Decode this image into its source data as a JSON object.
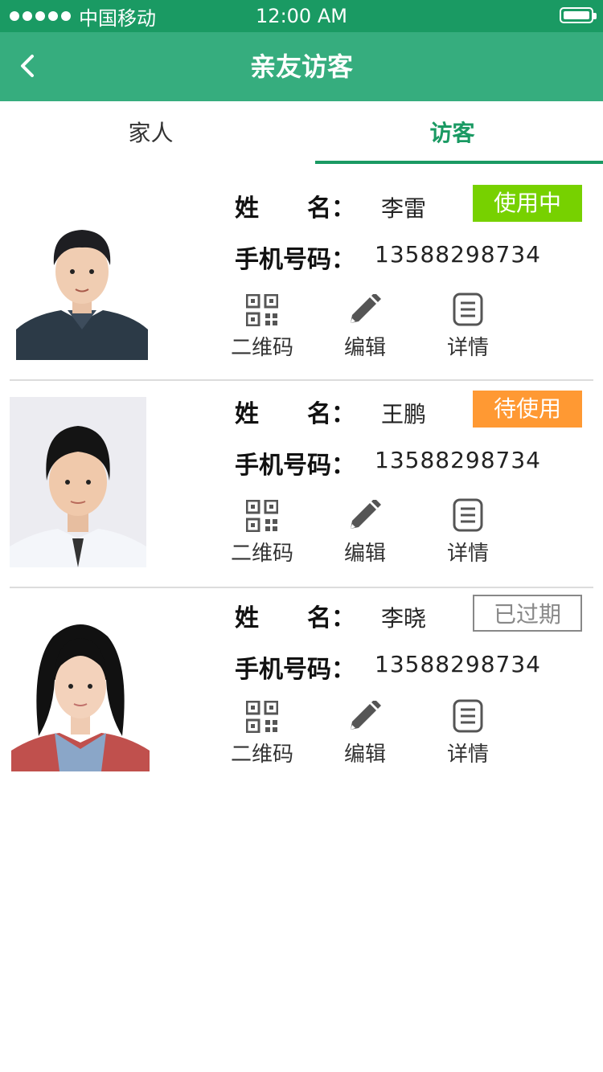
{
  "status_bar": {
    "carrier": "中国移动",
    "time": "12:00 AM"
  },
  "nav": {
    "title": "亲友访客"
  },
  "tabs": [
    {
      "label": "家人"
    },
    {
      "label": "访客"
    }
  ],
  "labels": {
    "name": "姓　　名：",
    "phone": "手机号码："
  },
  "actions": {
    "qr": "二维码",
    "edit": "编辑",
    "detail": "详情"
  },
  "colors": {
    "brand": "#1a9a63",
    "navbar": "#36ad7e",
    "status_in_use": "#77d100",
    "status_pending": "#ff9933",
    "status_expired": "#888888"
  },
  "visitors": [
    {
      "name": "李雷",
      "phone": "13588298734",
      "status": "使用中",
      "status_type": "in_use"
    },
    {
      "name": "王鹏",
      "phone": "13588298734",
      "status": "待使用",
      "status_type": "pending"
    },
    {
      "name": "李晓",
      "phone": "13588298734",
      "status": "已过期",
      "status_type": "expired"
    }
  ]
}
